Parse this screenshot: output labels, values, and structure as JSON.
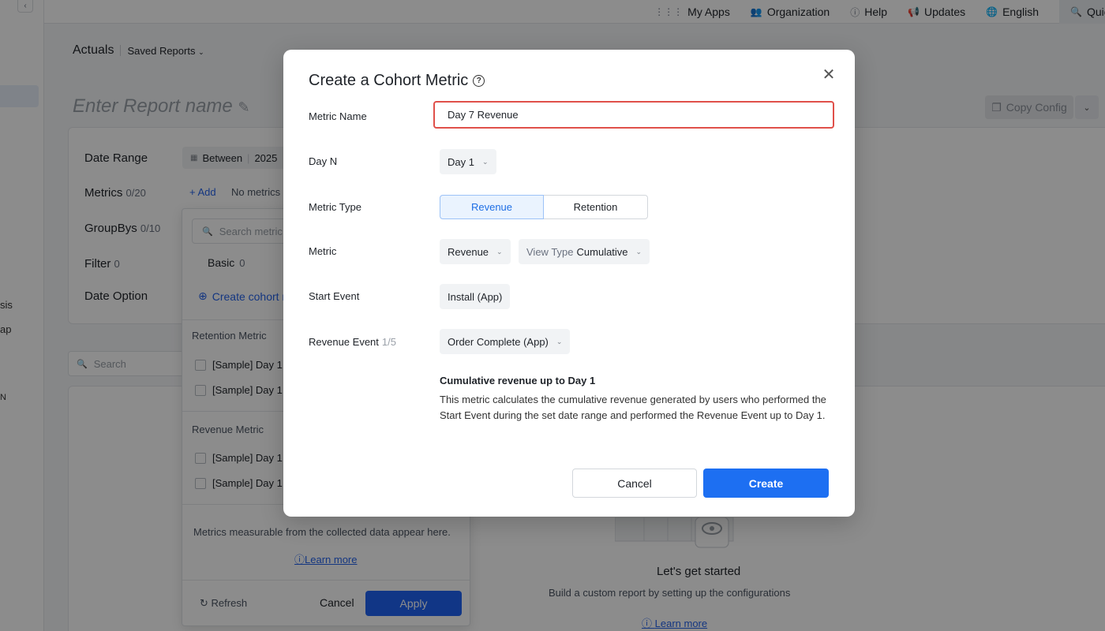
{
  "topnav": {
    "my_apps": "My Apps",
    "organization": "Organization",
    "help": "Help",
    "updates": "Updates",
    "english": "English",
    "quick": "Quic"
  },
  "sidebar": {
    "fragments": [
      "sis",
      "ap",
      "N"
    ]
  },
  "header": {
    "actuals": "Actuals",
    "saved_reports": "Saved Reports",
    "report_name_placeholder": "Enter Report name",
    "copy_config": "Copy Config"
  },
  "config": {
    "date_range_label": "Date Range",
    "date_range_value": "Between",
    "date_range_year": "2025",
    "metrics_label": "Metrics",
    "metrics_count": "0/20",
    "add_label": "+ Add",
    "no_metrics": "No metrics",
    "groupbys_label": "GroupBys",
    "groupbys_count": "0/10",
    "filter_label": "Filter",
    "filter_count": "0",
    "date_option_label": "Date Option"
  },
  "search": {
    "placeholder": "Search"
  },
  "metric_dropdown": {
    "search_placeholder": "Search metric",
    "tab_basic": "Basic",
    "tab_basic_count": "0",
    "create_cohort": "Create cohort m",
    "retention_section": "Retention Metric",
    "retention_items": [
      "[Sample] Day 1",
      "[Sample] Day 1"
    ],
    "revenue_section": "Revenue Metric",
    "revenue_items": [
      "[Sample] Day 1",
      "[Sample] Day 1"
    ],
    "note": "Metrics measurable from the collected data appear here.",
    "learn_more": "Learn more",
    "refresh": "Refresh",
    "cancel": "Cancel",
    "apply": "Apply"
  },
  "empty_state": {
    "title": "Let's get started",
    "subtitle": "Build a custom report by setting up the configurations",
    "learn_more": "Learn more"
  },
  "modal": {
    "title": "Create a Cohort Metric",
    "metric_name_label": "Metric Name",
    "metric_name_value": "Day 7 Revenue",
    "day_n_label": "Day N",
    "day_n_value": "Day 1",
    "metric_type_label": "Metric Type",
    "metric_type_options": [
      "Revenue",
      "Retention"
    ],
    "metric_type_selected": "Revenue",
    "metric_label": "Metric",
    "metric_value": "Revenue",
    "view_type_prefix": "View Type",
    "view_type_value": "Cumulative",
    "start_event_label": "Start Event",
    "start_event_value": "Install (App)",
    "revenue_event_label": "Revenue Event",
    "revenue_event_count": "1/5",
    "revenue_event_value": "Order Complete (App)",
    "description_title": "Cumulative revenue up to Day 1",
    "description_body": "This metric calculates the cumulative revenue generated by users who performed the Start Event during the set date range and performed the Revenue Event up to Day 1.",
    "cancel": "Cancel",
    "create": "Create"
  },
  "colors": {
    "accent": "#1d6ff2",
    "input_error_border": "#e0504a",
    "segment_active_bg": "#eaf3fe"
  }
}
